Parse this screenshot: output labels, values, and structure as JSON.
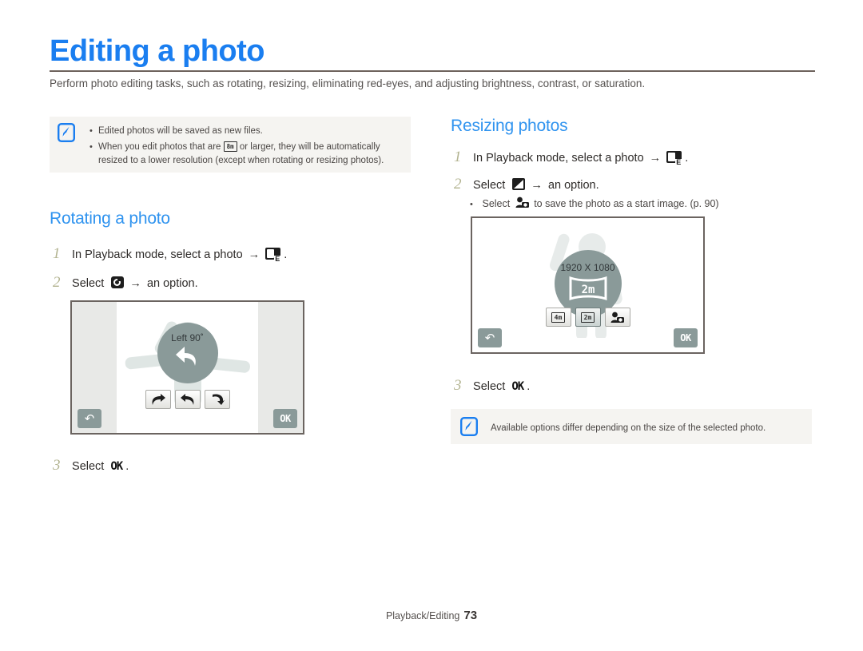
{
  "page": {
    "title": "Editing a photo",
    "subtitle": "Perform photo editing tasks, such as rotating, resizing, eliminating red-eyes, and adjusting brightness, contrast, or saturation.",
    "accent_color": "#1a7ef0",
    "heading_color": "#2f93ef",
    "rule_color": "#6d625c"
  },
  "top_note": {
    "icon": "note-pencil-icon",
    "items": [
      "Edited photos will be saved as new files.",
      "When you edit photos that are 8m or larger, they will be automatically resized to a lower resolution (except when rotating or resizing photos)."
    ],
    "item2_part1": "When you edit photos that are",
    "item2_chip": "8m",
    "item2_part2": "or larger, they will be automatically",
    "item2_line2": "resized to a lower resolution (except when rotating or resizing photos)."
  },
  "rotating": {
    "heading": "Rotating a photo",
    "steps": [
      {
        "num": "1",
        "text_before": "In Playback mode, select a photo",
        "arrow": "→",
        "icon": "photo-edit-icon",
        "text_after": "."
      },
      {
        "num": "2",
        "text_before": "Select",
        "arrow": "→",
        "icon": "rotate-icon",
        "text_after": "an option."
      },
      {
        "num": "3",
        "text_before": "Select",
        "icon": "ok-glyph",
        "label": "OK",
        "text_after": "."
      }
    ],
    "screen": {
      "selection_label": "Left 90˚",
      "center_icon": "rotate-left-arrow-icon",
      "buttons": [
        {
          "name": "rotate-right-button",
          "glyph": "rotate-right-arrow-icon"
        },
        {
          "name": "rotate-left-button",
          "glyph": "rotate-left-arrow-icon"
        },
        {
          "name": "flip-button",
          "glyph": "flip-arrow-icon"
        }
      ],
      "back_label": "↶",
      "ok_label": "OK"
    }
  },
  "resizing": {
    "heading": "Resizing photos",
    "steps": [
      {
        "num": "1",
        "text_before": "In Playback mode, select a photo",
        "arrow": "→",
        "icon": "photo-edit-icon",
        "text_after": "."
      },
      {
        "num": "2",
        "text_before": "Select",
        "arrow": "→",
        "icon": "resize-icon",
        "text_after": "an option."
      },
      {
        "num": "3",
        "text_before": "Select",
        "icon": "ok-glyph",
        "label": "OK",
        "text_after": "."
      }
    ],
    "substep": {
      "bullet": "•",
      "text_before": "Select",
      "icon": "start-image-icon",
      "text_after": "to save the photo as a start image. (p. 90)"
    },
    "screen": {
      "selection_label": "1920 X 1080",
      "center_chip": "2m",
      "buttons": [
        {
          "name": "size-4m-button",
          "label": "4m",
          "selected": false
        },
        {
          "name": "size-2m-button",
          "label": "2m",
          "selected": true
        },
        {
          "name": "start-image-button",
          "label": "start-image-icon",
          "selected": false
        }
      ],
      "back_label": "↶",
      "ok_label": "OK"
    },
    "note": {
      "icon": "note-pencil-icon",
      "text": "Available options differ depending on the size of the selected photo."
    }
  },
  "footer": {
    "section": "Playback/Editing",
    "page_number": "73"
  }
}
